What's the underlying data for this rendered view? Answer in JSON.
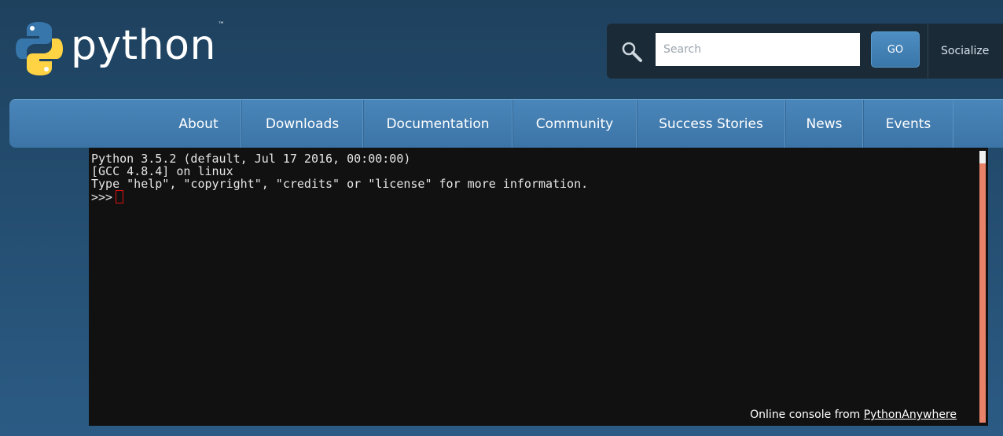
{
  "header": {
    "logo_text": "python",
    "logo_tm": "™",
    "search": {
      "placeholder": "Search",
      "value": ""
    },
    "go_label": "GO",
    "socialize_label": "Socialize"
  },
  "nav": {
    "items": [
      {
        "label": "About"
      },
      {
        "label": "Downloads"
      },
      {
        "label": "Documentation"
      },
      {
        "label": "Community"
      },
      {
        "label": "Success Stories"
      },
      {
        "label": "News"
      },
      {
        "label": "Events"
      }
    ]
  },
  "console": {
    "lines": [
      "Python 3.5.2 (default, Jul 17 2016, 00:00:00)",
      "[GCC 4.8.4] on linux",
      "Type \"help\", \"copyright\", \"credits\" or \"license\" for more information."
    ],
    "prompt": ">>>",
    "footer_prefix": "Online console from ",
    "footer_link": "PythonAnywhere"
  },
  "colors": {
    "background": "#2b5b84",
    "nav": "#3c74a6",
    "console_bg": "#111111",
    "scrollbar": "#e8836a",
    "logo_blue": "#3776ab",
    "logo_yellow": "#ffd343"
  }
}
